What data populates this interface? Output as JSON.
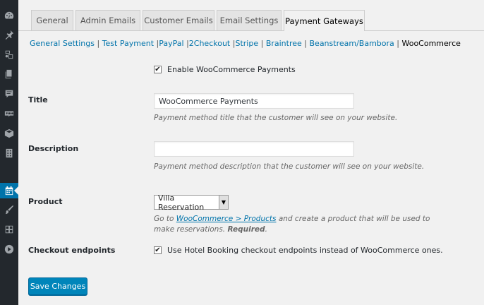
{
  "sidebar": {
    "icons": [
      "dashboard-icon",
      "pin-icon",
      "media-icon",
      "pages-icon",
      "comments-icon",
      "woo-icon",
      "box-icon",
      "building-icon",
      "calendar-icon",
      "brush-icon",
      "widget-icon",
      "play-icon"
    ],
    "active": "calendar-icon",
    "colors": {
      "bg": "#23282d",
      "icon": "#a0a5aa",
      "active": "#0073aa"
    }
  },
  "tabs": [
    {
      "label": "General"
    },
    {
      "label": "Admin Emails"
    },
    {
      "label": "Customer Emails"
    },
    {
      "label": "Email Settings"
    },
    {
      "label": "Payment Gateways",
      "active": true
    }
  ],
  "subnav": {
    "links": [
      "General Settings",
      "Test Payment",
      "PayPal",
      "2Checkout",
      "Stripe",
      "Braintree",
      "Beanstream/Bambora"
    ],
    "current": "WooCommerce",
    "separator": "|"
  },
  "form": {
    "enable": {
      "label": "Enable WooCommerce Payments",
      "checked": true
    },
    "title": {
      "label": "Title",
      "value": "WooCommerce Payments",
      "description": "Payment method title that the customer will see on your website."
    },
    "description": {
      "label": "Description",
      "value": "",
      "description": "Payment method description that the customer will see on your website."
    },
    "product": {
      "label": "Product",
      "selected": "Villa Reservation",
      "desc_prefix": "Go to",
      "desc_link": "WooCommerce > Products",
      "desc_middle": "and create a product that will be used to",
      "desc_line2": "make reservations.",
      "desc_required": "Required",
      "desc_end": "."
    },
    "checkout": {
      "label": "Checkout endpoints",
      "checkbox_label": "Use Hotel Booking checkout endpoints instead of WooCommerce ones.",
      "checked": true
    }
  },
  "save_button": "Save Changes",
  "colors": {
    "link": "#0073aa",
    "button": "#0085ba"
  }
}
